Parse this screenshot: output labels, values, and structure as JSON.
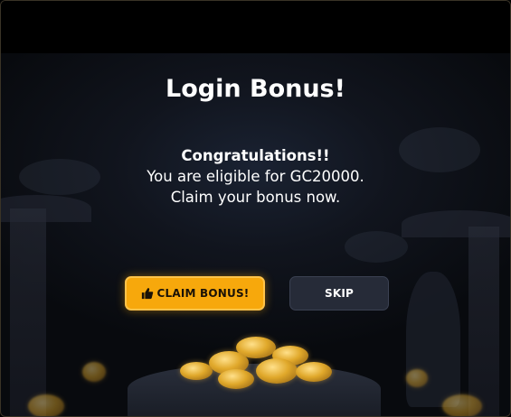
{
  "modal": {
    "title": "Login Bonus!",
    "message": {
      "heading": "Congratulations!!",
      "line1": "You are eligible for GC20000.",
      "line2": "Claim your bonus now."
    },
    "buttons": {
      "claim_label": "CLAIM BONUS!",
      "claim_icon": "thumbs-up-icon",
      "skip_label": "SKIP"
    }
  },
  "colors": {
    "claim_button": "#f7a80c",
    "skip_button": "#262b38",
    "text": "#ffffff"
  }
}
